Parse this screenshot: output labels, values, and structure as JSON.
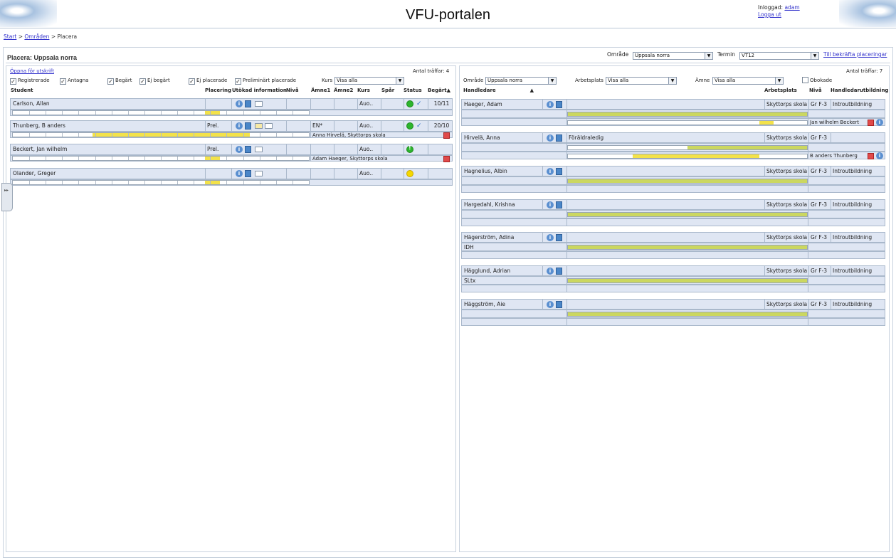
{
  "header": {
    "title": "VFU-portalen",
    "logged_in_label": "Inloggad:",
    "user": "adam",
    "logout": "Logga ut"
  },
  "breadcrumb": {
    "start": "Start",
    "sep1": ">",
    "areas": "Områden",
    "sep2": ">",
    "current": "Placera"
  },
  "page": {
    "title": "Placera: Uppsala norra",
    "area_label": "Område",
    "area_value": "Uppsala norra",
    "term_label": "Termin",
    "term_value": "VT12",
    "confirm_link": "Till bekräfta placeringar"
  },
  "students": {
    "print_link": "Öppna för utskrift",
    "hits": "Antal träffar: 4",
    "filters": [
      "Registrerade",
      "Antagna",
      "Begärt",
      "Ej begärt",
      "Ej placerade",
      "Preliminärt placerade"
    ],
    "course_label": "Kurs",
    "course_value": "Visa alla",
    "columns": [
      "Student",
      "Placering",
      "Utökad information",
      "Nivå",
      "Ämne1",
      "Ämne2",
      "Kurs",
      "Spår",
      "Status",
      "Begärt"
    ],
    "rows": [
      {
        "name": "Carlson, Allan",
        "placement": "",
        "subject1": "",
        "course": "Auo..",
        "status": "green",
        "requested": "10/11",
        "assigned": ""
      },
      {
        "name": "Thunberg, B anders",
        "placement": "Prel.",
        "subject1": "EN*",
        "course": "Auo..",
        "status": "green",
        "requested": "20/10",
        "assigned": "Anna Hirvelä, Skyttorps skola"
      },
      {
        "name": "Beckert, Jan wilhelm",
        "placement": "Prel.",
        "subject1": "",
        "course": "Auo..",
        "status": "green-alert",
        "requested": "",
        "assigned": "Adam Haeger, Skyttorps skola"
      },
      {
        "name": "Olander, Greger",
        "placement": "",
        "subject1": "",
        "course": "Auo..",
        "status": "yellow",
        "requested": "",
        "assigned": ""
      }
    ]
  },
  "supervisors": {
    "hits": "Antal träffar: 7",
    "area_label": "Område",
    "area_value": "Uppsala norra",
    "workplace_label": "Arbetsplats",
    "workplace_value": "Visa alla",
    "subject_label": "Ämne",
    "subject_value": "Visa alla",
    "unbooked_label": "Obokade",
    "columns": [
      "Handledare",
      "Arbetsplats",
      "Nivå",
      "Handledarutbildning"
    ],
    "rows": [
      {
        "name": "Haeger, Adam",
        "note": "",
        "workplace": "Skyttorps skola",
        "level": "Gr F-3",
        "training": "Introutbildning",
        "assigned": "Jan wilhelm Beckert"
      },
      {
        "name": "Hirvelä, Anna",
        "note": "Föräldraledig",
        "workplace": "Skyttorps skola",
        "level": "Gr F-3",
        "training": "",
        "assigned": "B anders Thunberg"
      },
      {
        "name": "Hagnelius, Albin",
        "note": "",
        "workplace": "Skyttorps skola",
        "level": "Gr F-3",
        "training": "Introutbildning",
        "assigned": ""
      },
      {
        "name": "Hargedahl, Krishna",
        "note": "",
        "workplace": "Skyttorps skola",
        "level": "Gr F-3",
        "training": "Introutbildning",
        "assigned": ""
      },
      {
        "name": "Hägerström, Adina",
        "note": "IDH",
        "workplace": "Skyttorps skola",
        "level": "Gr F-3",
        "training": "Introutbildning",
        "assigned": ""
      },
      {
        "name": "Hägglund, Adrian",
        "note": "SLtx",
        "workplace": "Skyttorps skola",
        "level": "Gr F-3",
        "training": "Introutbildning",
        "assigned": ""
      },
      {
        "name": "Häggström, Aie",
        "note": "",
        "workplace": "Skyttorps skola",
        "level": "Gr F-3",
        "training": "Introutbildning",
        "assigned": ""
      }
    ]
  },
  "colors": {
    "green": "#2db52d",
    "yellow": "#f5d800",
    "bar_yellow": "#f3e24a",
    "bar_olive": "#cbd760"
  }
}
